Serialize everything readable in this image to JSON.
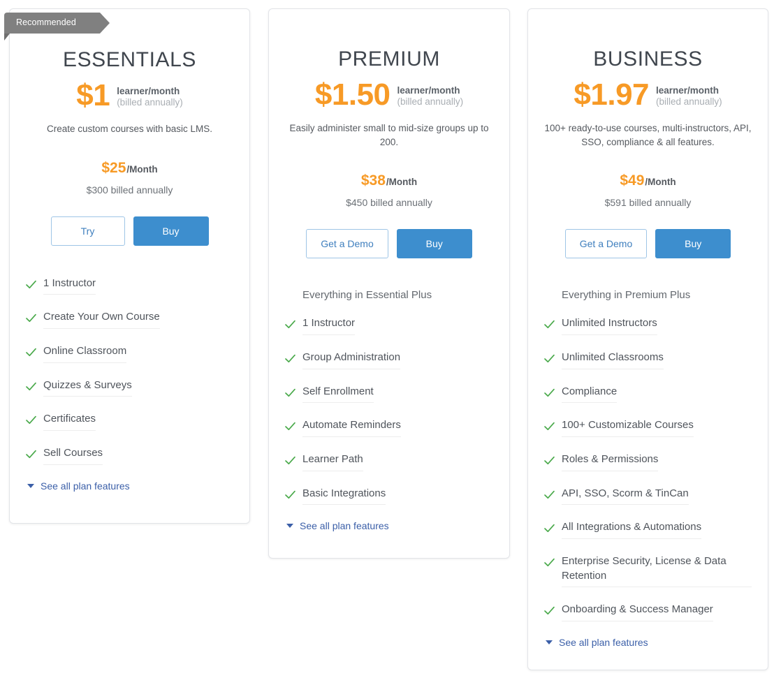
{
  "ribbon": {
    "label": "Recommended"
  },
  "plans": [
    {
      "id": "essentials",
      "title": "ESSENTIALS",
      "headline_amount": "$1",
      "unit_primary": "learner/month",
      "unit_secondary": "(billed annually)",
      "tagline": "Create custom courses with basic LMS.",
      "monthly_amount": "$25",
      "monthly_period": "/Month",
      "annual_note": "$300 billed annually",
      "secondary_button": "Try",
      "primary_button": "Buy",
      "features_heading": "",
      "features": [
        "1 Instructor",
        "Create Your Own Course",
        "Online Classroom",
        "Quizzes & Surveys",
        "Certificates",
        "Sell Courses"
      ],
      "see_all_label": "See all plan features"
    },
    {
      "id": "premium",
      "title": "PREMIUM",
      "headline_amount": "$1.50",
      "unit_primary": "learner/month",
      "unit_secondary": "(billed annually)",
      "tagline": "Easily administer small to mid-size groups up to 200.",
      "monthly_amount": "$38",
      "monthly_period": "/Month",
      "annual_note": "$450 billed annually",
      "secondary_button": "Get a Demo",
      "primary_button": "Buy",
      "features_heading": "Everything in Essential Plus",
      "features": [
        "1 Instructor",
        "Group Administration",
        "Self Enrollment",
        "Automate Reminders",
        "Learner Path",
        "Basic Integrations"
      ],
      "see_all_label": "See all plan features"
    },
    {
      "id": "business",
      "title": "BUSINESS",
      "headline_amount": "$1.97",
      "unit_primary": "learner/month",
      "unit_secondary": "(billed annually)",
      "tagline": "100+ ready-to-use courses, multi-instructors, API, SSO, compliance & all features.",
      "monthly_amount": "$49",
      "monthly_period": "/Month",
      "annual_note": "$591 billed annually",
      "secondary_button": "Get a Demo",
      "primary_button": "Buy",
      "features_heading": "Everything in Premium Plus",
      "features": [
        "Unlimited Instructors",
        "Unlimited Classrooms",
        "Compliance",
        "100+ Customizable Courses",
        "Roles & Permissions",
        "API, SSO, Scorm & TinCan",
        "All Integrations & Automations",
        "Enterprise Security, License & Data Retention",
        "Onboarding & Success Manager"
      ],
      "see_all_label": "See all plan features"
    }
  ],
  "colors": {
    "price_orange": "#f79a26",
    "primary_blue": "#3d8ece",
    "link_blue": "#3b5fa8",
    "check_green": "#49a94a",
    "ribbon_gray": "#808080",
    "title_gray": "#40464e"
  },
  "icons": {
    "check": "check-icon",
    "caret": "chevron-down-icon"
  }
}
